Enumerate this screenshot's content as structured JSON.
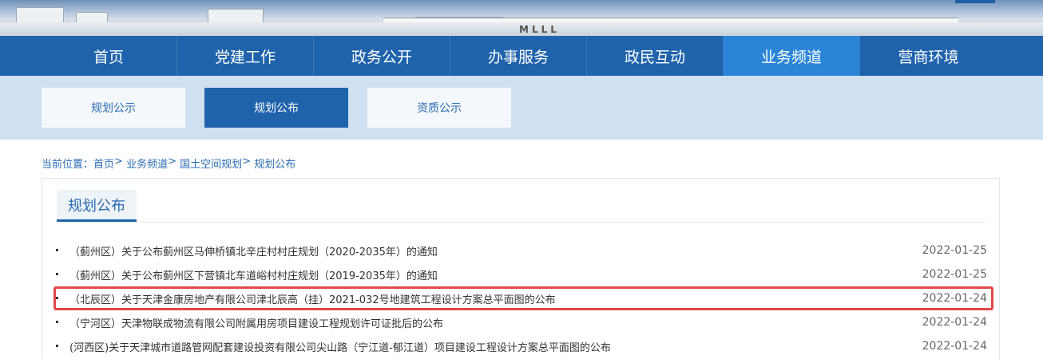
{
  "nav": {
    "items": [
      {
        "label": "首页"
      },
      {
        "label": "党建工作"
      },
      {
        "label": "政务公开"
      },
      {
        "label": "办事服务"
      },
      {
        "label": "政民互动"
      },
      {
        "label": "业务频道"
      },
      {
        "label": "营商环境"
      }
    ],
    "active_index": 5
  },
  "subnav": {
    "tabs": [
      {
        "label": "规划公示"
      },
      {
        "label": "规划公布"
      },
      {
        "label": "资质公示"
      }
    ],
    "active_index": 1
  },
  "breadcrumb": {
    "prefix": "当前位置：",
    "items": [
      "首页",
      "业务频道",
      "国土空间规划",
      "规划公布"
    ],
    "separator": ">"
  },
  "panel": {
    "title": "规划公布",
    "items": [
      {
        "text": "（蓟州区）关于公布蓟州区马伸桥镇北辛庄村村庄规划（2020-2035年）的通知",
        "date": "2022-01-25"
      },
      {
        "text": "（蓟州区）关于公布蓟州区下营镇北车道峪村村庄规划（2019-2035年）的通知",
        "date": "2022-01-25"
      },
      {
        "text": "（北辰区）关于天津金康房地产有限公司津北辰高（挂）2021-032号地建筑工程设计方案总平面图的公布",
        "date": "2022-01-24",
        "highlighted": true
      },
      {
        "text": "（宁河区）天津物联成物流有限公司附属用房项目建设工程规划许可证批后的公布",
        "date": "2022-01-24"
      },
      {
        "text": "(河西区)关于天津城市道路管网配套建设投资有限公司尖山路（宁江道-郁江道）项目建设工程设计方案总平面图的公布",
        "date": "2022-01-24"
      }
    ]
  },
  "banner": {
    "sign_text": "MLLL"
  },
  "colors": {
    "primary": "#1f63ac",
    "active_nav": "#2a85d8",
    "subnav_bg": "#cfe0f0",
    "highlight": "#e04848",
    "link": "#2a6bb3"
  }
}
